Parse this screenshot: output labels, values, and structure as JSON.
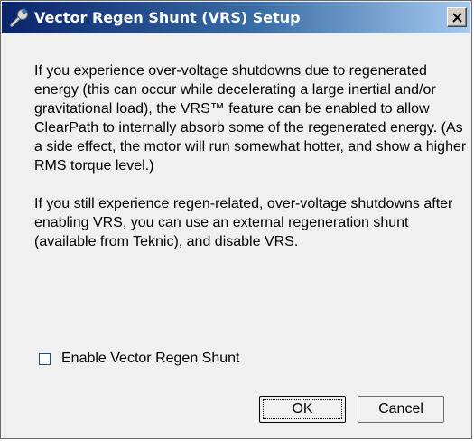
{
  "window": {
    "title": "Vector Regen Shunt (VRS) Setup",
    "title_icon": "wrench-icon",
    "close_icon": "close-icon"
  },
  "body": {
    "paragraph_1": "If you experience over-voltage shutdowns due to regenerated energy (this can occur while decelerating a large inertial and/or gravitational load), the VRS™ feature can be enabled to allow ClearPath to internally absorb some of the regenerated energy. (As a side effect, the motor will run somewhat hotter, and show a higher RMS torque level.)",
    "paragraph_2": "If you still experience regen-related, over-voltage shutdowns after enabling VRS, you can use an external regeneration shunt (available from Teknic), and disable VRS."
  },
  "checkbox": {
    "label": "Enable Vector Regen Shunt",
    "checked": false
  },
  "buttons": {
    "ok": "OK",
    "cancel": "Cancel"
  },
  "colors": {
    "title_gradient_start": "#0a246a",
    "title_gradient_end": "#a6caf0",
    "dialog_background": "#f0f0f0"
  }
}
